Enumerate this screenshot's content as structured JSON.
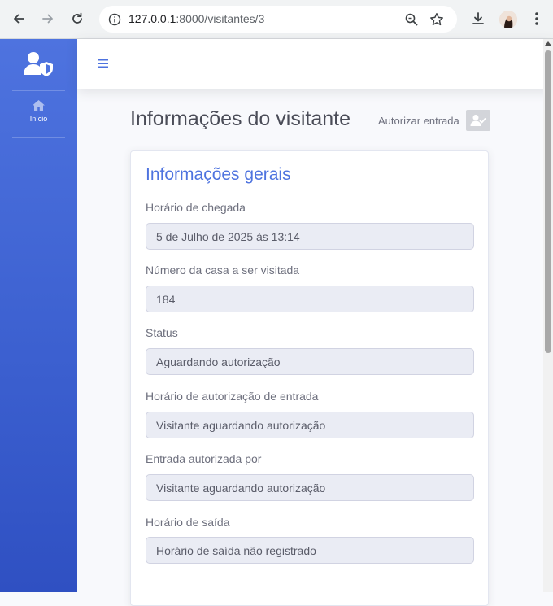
{
  "browser": {
    "url_host": "127.0.0.1",
    "url_rest": ":8000/visitantes/3"
  },
  "sidebar": {
    "items": [
      {
        "label": "Início",
        "icon": "home-icon"
      }
    ]
  },
  "page": {
    "title": "Informações do visitante",
    "authorize_label": "Autorizar entrada"
  },
  "card": {
    "title": "Informações gerais",
    "fields": [
      {
        "label": "Horário de chegada",
        "value": "5 de Julho de 2025 às 13:14"
      },
      {
        "label": "Número da casa a ser visitada",
        "value": "184"
      },
      {
        "label": "Status",
        "value": "Aguardando autorização"
      },
      {
        "label": "Horário de autorização de entrada",
        "value": "Visitante aguardando autorização"
      },
      {
        "label": "Entrada autorizada por",
        "value": "Visitante aguardando autorização"
      },
      {
        "label": "Horário de saída",
        "value": "Horário de saída não registrado"
      }
    ]
  },
  "colors": {
    "primary": "#4e73df",
    "sidebar_dark": "#2f50c2",
    "input_bg": "#eaecf4"
  }
}
